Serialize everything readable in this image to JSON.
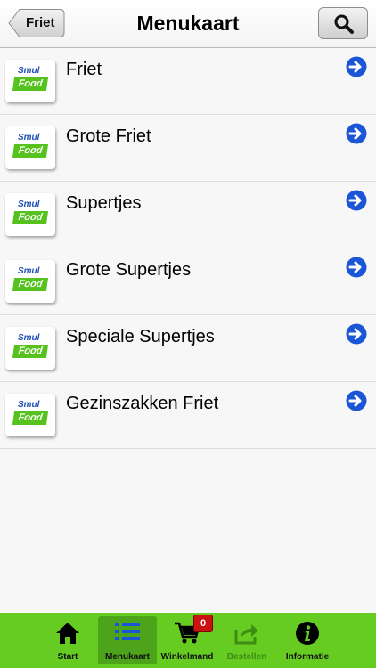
{
  "navbar": {
    "back_label": "Friet",
    "title": "Menukaart"
  },
  "items": [
    {
      "label": "Friet"
    },
    {
      "label": "Grote Friet"
    },
    {
      "label": "Supertjes"
    },
    {
      "label": "Grote Supertjes"
    },
    {
      "label": "Speciale Supertjes"
    },
    {
      "label": "Gezinszakken Friet"
    }
  ],
  "logo": {
    "line1": "Smul",
    "line2": "Food"
  },
  "tabs": [
    {
      "label": "Start",
      "icon": "home-icon"
    },
    {
      "label": "Menukaart",
      "icon": "list-icon",
      "active": true
    },
    {
      "label": "Winkelmand",
      "icon": "cart-icon",
      "badge": "0"
    },
    {
      "label": "Bestellen",
      "icon": "share-icon",
      "disabled": true
    },
    {
      "label": "Informatie",
      "icon": "info-icon"
    }
  ],
  "colors": {
    "tabbar": "#66cc22",
    "accent_blue": "#1a56d6",
    "badge": "#cc1111"
  }
}
